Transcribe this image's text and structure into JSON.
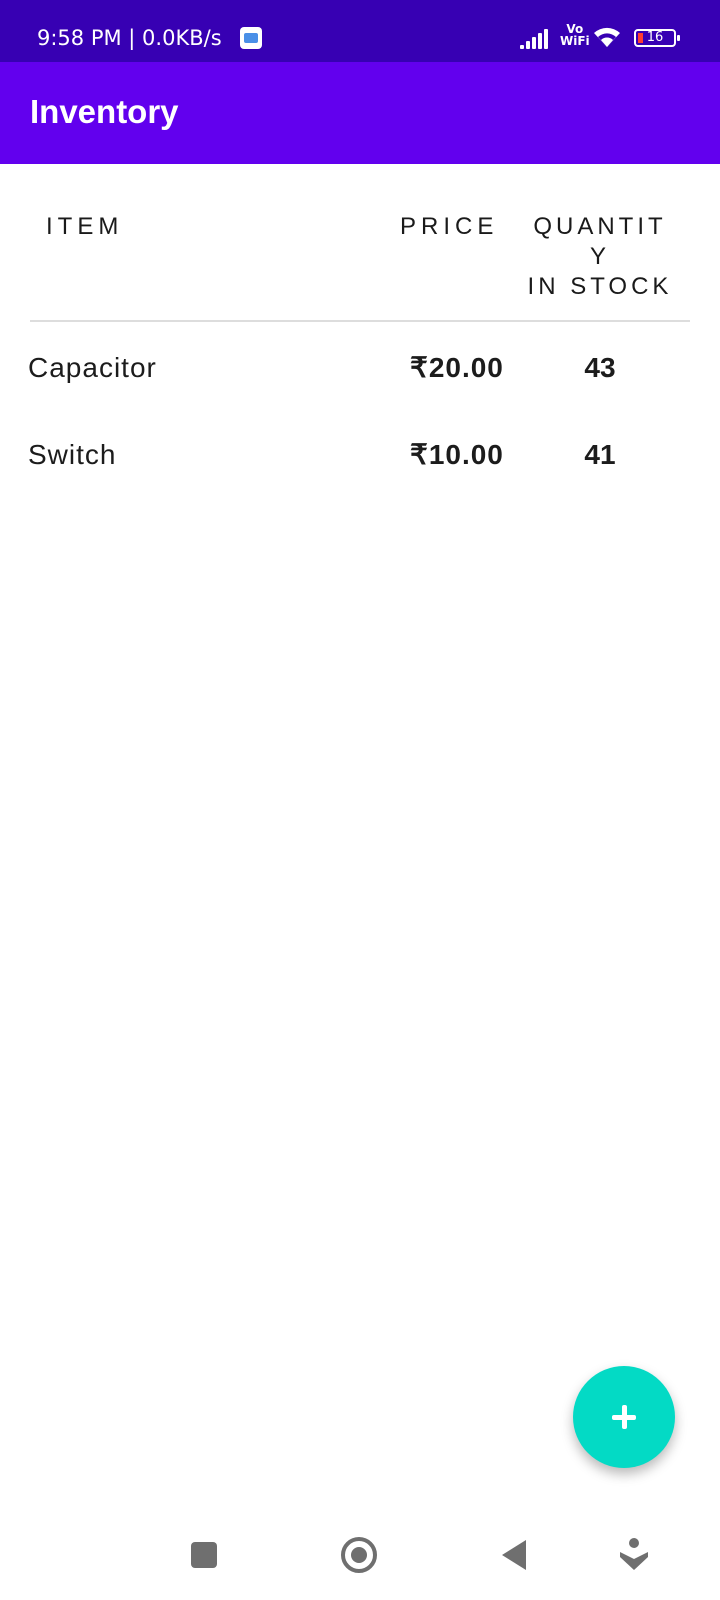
{
  "status_bar": {
    "time_text": "9:58 PM | 0.0KB/s",
    "network_label_top": "Vo",
    "network_label_bottom": "WiFi",
    "battery_level": "16",
    "background_color": "#3700b3"
  },
  "app_bar": {
    "title": "Inventory",
    "background_color": "#6200ee"
  },
  "table": {
    "headers": {
      "item": "ITEM",
      "price": "PRICE",
      "quantity_line1": "QUANTIT",
      "quantity_line2": "Y",
      "quantity_line3": "IN STOCK"
    },
    "rows": [
      {
        "name": "Capacitor",
        "price": "₹20.00",
        "quantity": "43"
      },
      {
        "name": "Switch",
        "price": "₹10.00",
        "quantity": "41"
      }
    ]
  },
  "fab": {
    "icon": "plus-icon",
    "color": "#03dac5"
  },
  "nav_bar": {
    "icons": [
      "recents-square-icon",
      "home-circle-icon",
      "back-triangle-icon",
      "assistant-icon"
    ]
  }
}
